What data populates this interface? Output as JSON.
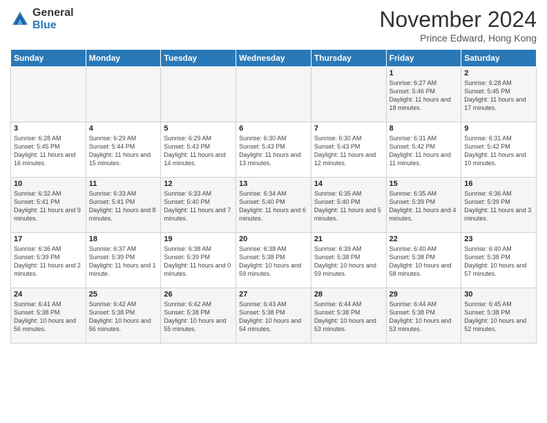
{
  "header": {
    "logo_general": "General",
    "logo_blue": "Blue",
    "month_title": "November 2024",
    "location": "Prince Edward, Hong Kong"
  },
  "weekdays": [
    "Sunday",
    "Monday",
    "Tuesday",
    "Wednesday",
    "Thursday",
    "Friday",
    "Saturday"
  ],
  "weeks": [
    [
      {
        "day": "",
        "info": ""
      },
      {
        "day": "",
        "info": ""
      },
      {
        "day": "",
        "info": ""
      },
      {
        "day": "",
        "info": ""
      },
      {
        "day": "",
        "info": ""
      },
      {
        "day": "1",
        "info": "Sunrise: 6:27 AM\nSunset: 5:46 PM\nDaylight: 11 hours and 18 minutes."
      },
      {
        "day": "2",
        "info": "Sunrise: 6:28 AM\nSunset: 5:45 PM\nDaylight: 11 hours and 17 minutes."
      }
    ],
    [
      {
        "day": "3",
        "info": "Sunrise: 6:28 AM\nSunset: 5:45 PM\nDaylight: 11 hours and 16 minutes."
      },
      {
        "day": "4",
        "info": "Sunrise: 6:29 AM\nSunset: 5:44 PM\nDaylight: 11 hours and 15 minutes."
      },
      {
        "day": "5",
        "info": "Sunrise: 6:29 AM\nSunset: 5:43 PM\nDaylight: 11 hours and 14 minutes."
      },
      {
        "day": "6",
        "info": "Sunrise: 6:30 AM\nSunset: 5:43 PM\nDaylight: 11 hours and 13 minutes."
      },
      {
        "day": "7",
        "info": "Sunrise: 6:30 AM\nSunset: 5:43 PM\nDaylight: 11 hours and 12 minutes."
      },
      {
        "day": "8",
        "info": "Sunrise: 6:31 AM\nSunset: 5:42 PM\nDaylight: 11 hours and 11 minutes."
      },
      {
        "day": "9",
        "info": "Sunrise: 6:31 AM\nSunset: 5:42 PM\nDaylight: 11 hours and 10 minutes."
      }
    ],
    [
      {
        "day": "10",
        "info": "Sunrise: 6:32 AM\nSunset: 5:41 PM\nDaylight: 11 hours and 9 minutes."
      },
      {
        "day": "11",
        "info": "Sunrise: 6:33 AM\nSunset: 5:41 PM\nDaylight: 11 hours and 8 minutes."
      },
      {
        "day": "12",
        "info": "Sunrise: 6:33 AM\nSunset: 5:40 PM\nDaylight: 11 hours and 7 minutes."
      },
      {
        "day": "13",
        "info": "Sunrise: 6:34 AM\nSunset: 5:40 PM\nDaylight: 11 hours and 6 minutes."
      },
      {
        "day": "14",
        "info": "Sunrise: 6:35 AM\nSunset: 5:40 PM\nDaylight: 11 hours and 5 minutes."
      },
      {
        "day": "15",
        "info": "Sunrise: 6:35 AM\nSunset: 5:39 PM\nDaylight: 11 hours and 4 minutes."
      },
      {
        "day": "16",
        "info": "Sunrise: 6:36 AM\nSunset: 5:39 PM\nDaylight: 11 hours and 3 minutes."
      }
    ],
    [
      {
        "day": "17",
        "info": "Sunrise: 6:36 AM\nSunset: 5:39 PM\nDaylight: 11 hours and 2 minutes."
      },
      {
        "day": "18",
        "info": "Sunrise: 6:37 AM\nSunset: 5:39 PM\nDaylight: 11 hours and 1 minute."
      },
      {
        "day": "19",
        "info": "Sunrise: 6:38 AM\nSunset: 5:39 PM\nDaylight: 11 hours and 0 minutes."
      },
      {
        "day": "20",
        "info": "Sunrise: 6:38 AM\nSunset: 5:38 PM\nDaylight: 10 hours and 59 minutes."
      },
      {
        "day": "21",
        "info": "Sunrise: 6:39 AM\nSunset: 5:38 PM\nDaylight: 10 hours and 59 minutes."
      },
      {
        "day": "22",
        "info": "Sunrise: 6:40 AM\nSunset: 5:38 PM\nDaylight: 10 hours and 58 minutes."
      },
      {
        "day": "23",
        "info": "Sunrise: 6:40 AM\nSunset: 5:38 PM\nDaylight: 10 hours and 57 minutes."
      }
    ],
    [
      {
        "day": "24",
        "info": "Sunrise: 6:41 AM\nSunset: 5:38 PM\nDaylight: 10 hours and 56 minutes."
      },
      {
        "day": "25",
        "info": "Sunrise: 6:42 AM\nSunset: 5:38 PM\nDaylight: 10 hours and 56 minutes."
      },
      {
        "day": "26",
        "info": "Sunrise: 6:42 AM\nSunset: 5:38 PM\nDaylight: 10 hours and 55 minutes."
      },
      {
        "day": "27",
        "info": "Sunrise: 6:43 AM\nSunset: 5:38 PM\nDaylight: 10 hours and 54 minutes."
      },
      {
        "day": "28",
        "info": "Sunrise: 6:44 AM\nSunset: 5:38 PM\nDaylight: 10 hours and 53 minutes."
      },
      {
        "day": "29",
        "info": "Sunrise: 6:44 AM\nSunset: 5:38 PM\nDaylight: 10 hours and 53 minutes."
      },
      {
        "day": "30",
        "info": "Sunrise: 6:45 AM\nSunset: 5:38 PM\nDaylight: 10 hours and 52 minutes."
      }
    ]
  ]
}
